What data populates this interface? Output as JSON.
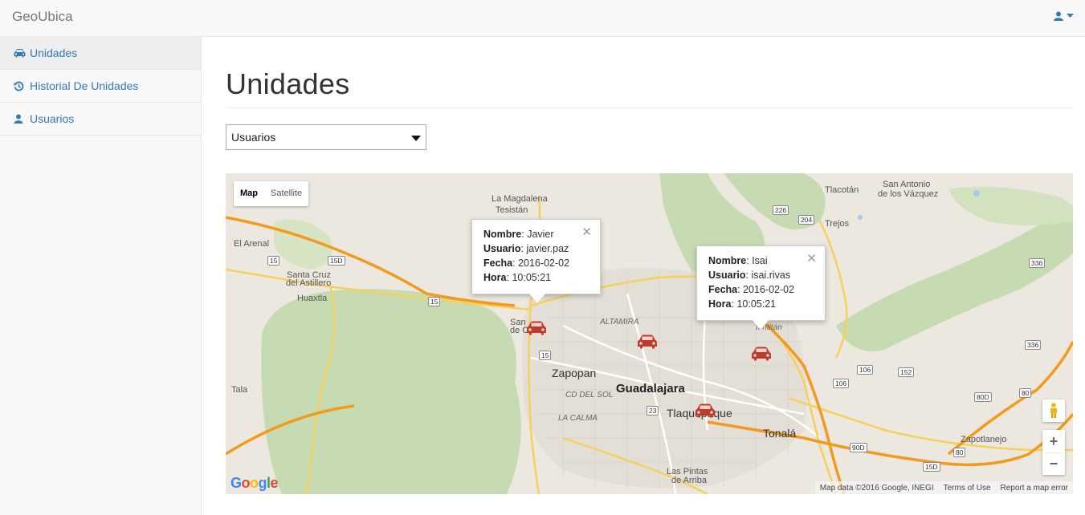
{
  "navbar": {
    "brand": "GeoUbica",
    "user_icon": "user-icon"
  },
  "sidebar": {
    "items": [
      {
        "label": "Unidades",
        "icon": "car-icon",
        "active": true
      },
      {
        "label": "Historial De Unidades",
        "icon": "history-icon",
        "active": false
      },
      {
        "label": "Usuarios",
        "icon": "user-icon",
        "active": false
      }
    ]
  },
  "main": {
    "title": "Unidades",
    "select": {
      "value": "Usuarios"
    }
  },
  "map": {
    "type_buttons": {
      "map": "Map",
      "satellite": "Satellite"
    },
    "infowindows": [
      {
        "nombre_label": "Nombre",
        "nombre": "Javier",
        "usuario_label": "Usuario",
        "usuario": "javier.paz",
        "fecha_label": "Fecha",
        "fecha": "2016-02-02",
        "hora_label": "Hora",
        "hora": "10:05:21"
      },
      {
        "nombre_label": "Nombre",
        "nombre": "Isai",
        "usuario_label": "Usuario",
        "usuario": "isai.rivas",
        "fecha_label": "Fecha",
        "fecha": "2016-02-02",
        "hora_label": "Hora",
        "hora": "10:05:21"
      }
    ],
    "labels": {
      "magdalena": "La Magdalena",
      "tesistan": "Tesistán",
      "el_arenal": "El Arenal",
      "santa_cruz": "Santa Cruz",
      "del_astillero": "del Astillero",
      "huaxtla": "Huaxtla",
      "tala": "Tala",
      "zapopan": "Zapopan",
      "guadalajara": "Guadalajara",
      "cd_del_sol": "CD DEL SOL",
      "la_calma": "LA CALMA",
      "altamira": "ALTAMIRA",
      "tlaquepaque": "Tlaquepaque",
      "tonala": "Tonalá",
      "las_pintas": "Las Pintas",
      "de_arriba": "de Arriba",
      "tlacotan": "Tlacotán",
      "san_antonio": "San Antonio",
      "de_los_vazquez": "de los Vázquez",
      "trejos": "Trejos",
      "zapotlanejo": "Zapotlanejo",
      "san": "San",
      "de_c": "de C",
      "tentitan": "tentitán"
    },
    "shields": [
      "15",
      "15D",
      "15",
      "15",
      "23",
      "226",
      "204",
      "336",
      "336",
      "106",
      "106",
      "152",
      "80D",
      "80",
      "90D",
      "15D",
      "80"
    ],
    "attribution": {
      "data": "Map data ©2016 Google, INEGI",
      "terms": "Terms of Use",
      "report": "Report a map error"
    },
    "logo": "Google"
  }
}
